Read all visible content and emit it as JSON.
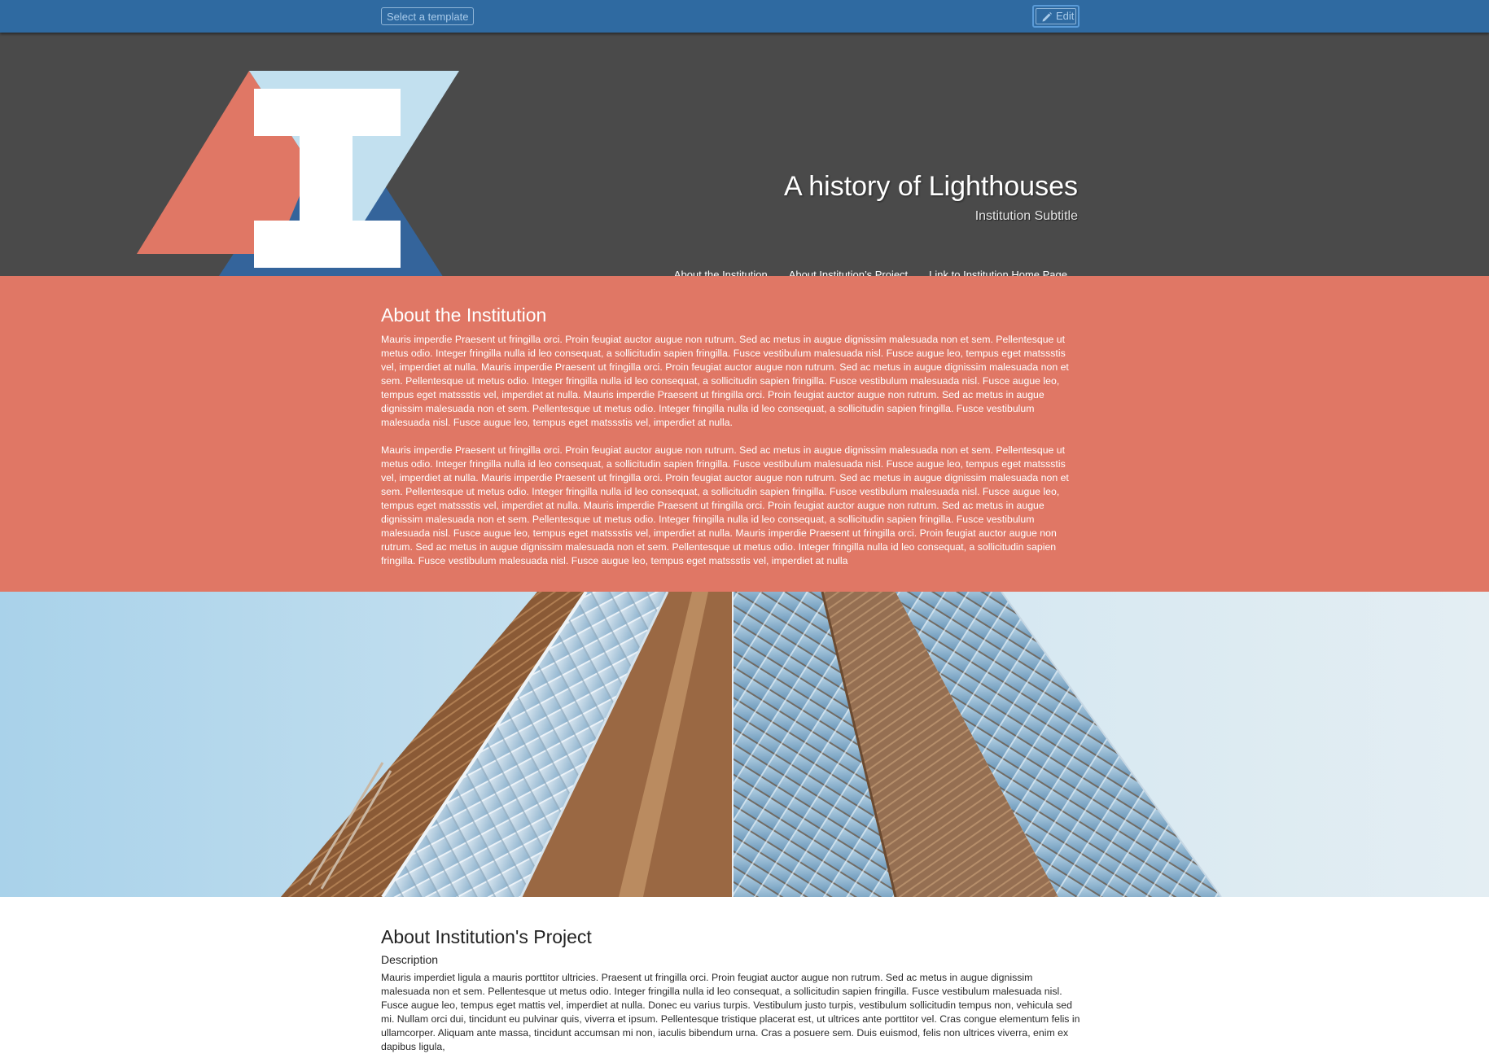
{
  "toolbar": {
    "template_label": "Select a template",
    "edit_label": "Edit"
  },
  "header": {
    "title": "A history of Lighthouses",
    "subtitle": "Institution Subtitle",
    "logo_letter": "I",
    "nav": [
      {
        "label": "About the Institution"
      },
      {
        "label": "About Institution’s Project"
      },
      {
        "label": "Link to Institution Home Page"
      }
    ]
  },
  "about": {
    "title": "About the Institution",
    "paragraphs": [
      "Mauris imperdie Praesent ut fringilla orci. Proin feugiat auctor augue non rutrum. Sed ac metus in augue dignissim malesuada non et sem. Pellentesque ut metus odio. Integer fringilla nulla id leo consequat, a sollicitudin sapien fringilla. Fusce vestibulum malesuada nisl. Fusce augue leo, tempus eget matssstis vel, imperdiet at nulla. Mauris imperdie Praesent ut fringilla orci. Proin feugiat auctor augue non rutrum. Sed ac metus in augue dignissim malesuada non et sem. Pellentesque ut metus odio. Integer fringilla nulla id leo consequat, a sollicitudin sapien fringilla. Fusce vestibulum malesuada nisl. Fusce augue leo, tempus eget matssstis vel, imperdiet at nulla. Mauris imperdie Praesent ut fringilla orci. Proin feugiat auctor augue non rutrum. Sed ac metus in augue dignissim malesuada non et sem. Pellentesque ut metus odio. Integer fringilla nulla id leo consequat, a sollicitudin sapien fringilla. Fusce vestibulum malesuada nisl. Fusce augue leo, tempus eget matssstis vel, imperdiet at nulla.",
      "Mauris imperdie Praesent ut fringilla orci. Proin feugiat auctor augue non rutrum. Sed ac metus in augue dignissim malesuada non et sem. Pellentesque ut metus odio. Integer fringilla nulla id leo consequat, a sollicitudin sapien fringilla. Fusce vestibulum malesuada nisl. Fusce augue leo, tempus eget matssstis vel, imperdiet at nulla. Mauris imperdie Praesent ut fringilla orci. Proin feugiat auctor augue non rutrum. Sed ac metus in augue dignissim malesuada non et sem. Pellentesque ut metus odio. Integer fringilla nulla id leo consequat, a sollicitudin sapien fringilla. Fusce vestibulum malesuada nisl. Fusce augue leo, tempus eget matssstis vel, imperdiet at nulla. Mauris imperdie Praesent ut fringilla orci. Proin feugiat auctor augue non rutrum. Sed ac metus in augue dignissim malesuada non et sem. Pellentesque ut metus odio. Integer fringilla nulla id leo consequat, a sollicitudin sapien fringilla. Fusce vestibulum malesuada nisl. Fusce augue leo, tempus eget matssstis vel, imperdiet at nulla. Mauris imperdie Praesent ut fringilla orci. Proin feugiat auctor augue non rutrum. Sed ac metus in augue dignissim malesuada non et sem. Pellentesque ut metus odio. Integer fringilla nulla id leo consequat, a sollicitudin sapien fringilla. Fusce vestibulum malesuada nisl. Fusce augue leo, tempus eget matssstis vel, imperdiet at nulla"
    ]
  },
  "project": {
    "title": "About Institution's Project",
    "subtitle": "Description",
    "paragraph": "Mauris imperdiet ligula a mauris porttitor ultricies. Praesent ut fringilla orci. Proin feugiat auctor augue non rutrum. Sed ac metus in augue dignissim malesuada non et sem. Pellentesque ut metus odio. Integer fringilla nulla id leo consequat, a sollicitudin sapien fringilla. Fusce vestibulum malesuada nisl. Fusce augue leo, tempus eget mattis vel, imperdiet at nulla. Donec eu varius turpis. Vestibulum justo turpis, vestibulum sollicitudin tempus non, vehicula sed mi. Nullam orci dui, tincidunt eu pulvinar quis, viverra et ipsum. Pellentesque tristique placerat est, ut ultrices ante porttitor vel. Cras congue elementum felis in ullamcorper. Aliquam ante massa, tincidunt accumsan mi non, iaculis bibendum urna. Cras a posuere sem. Duis euismod, felis non ultrices viverra, enim ex dapibus ligula,"
  },
  "colors": {
    "toolbar": "#2f6aa1",
    "header": "#4a4a4a",
    "about_background": "#e07765",
    "logo_salmon": "#e07765",
    "logo_light_blue": "#c2e0ef",
    "logo_dark_blue": "#34649b"
  }
}
